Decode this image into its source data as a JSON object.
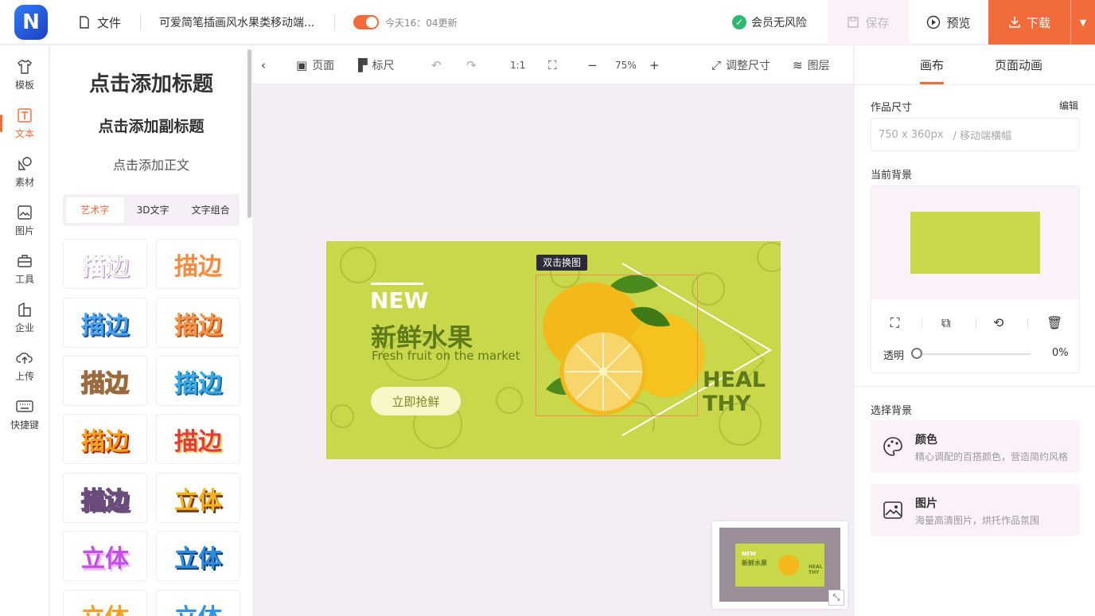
{
  "topbar": {
    "logo_letter": "N",
    "file_menu": "文件",
    "doc_title": "可爱简笔插画风水果类移动端...",
    "updated": "今天16：04更新",
    "member_safe": "会员无风险",
    "save": "保存",
    "preview": "预览",
    "download": "下载"
  },
  "nav": {
    "items": [
      {
        "label": "模板"
      },
      {
        "label": "文本"
      },
      {
        "label": "素材"
      },
      {
        "label": "图片"
      },
      {
        "label": "工具"
      },
      {
        "label": "企业"
      },
      {
        "label": "上传"
      },
      {
        "label": "快捷键"
      }
    ]
  },
  "text_panel": {
    "add_title": "点击添加标题",
    "add_subtitle": "点击添加副标题",
    "add_body": "点击添加正文",
    "tabs": [
      "艺术字",
      "3D文字",
      "文字组合"
    ],
    "styles": [
      "描边",
      "描边",
      "描边",
      "描边",
      "描边",
      "描边",
      "描边",
      "描边",
      "描边",
      "立体",
      "立体",
      "立体",
      "立体",
      "立体"
    ]
  },
  "toolbar": {
    "page": "页面",
    "ruler": "标尺",
    "ratio": "1:1",
    "zoom": "75%",
    "resize": "调整尺寸",
    "layers": "图层"
  },
  "banner": {
    "tooltip": "双击换图",
    "new": "NEW",
    "title": "新鲜水果",
    "subtitle": "Fresh fruit on the market",
    "cta": "立即抢鲜",
    "healthy_1": "HEAL",
    "healthy_2": "THY"
  },
  "right_panel": {
    "tab_canvas": "画布",
    "tab_animation": "页面动画",
    "size_label": "作品尺寸",
    "edit": "编辑",
    "size_value": "750 x 360px",
    "size_type": "/ 移动端横幅",
    "current_bg": "当前背景",
    "opacity_label": "透明",
    "opacity_value": "0%",
    "choose_bg": "选择背景",
    "options": [
      {
        "title": "颜色",
        "desc": "精心调配的百搭颜色，营造简约风格"
      },
      {
        "title": "图片",
        "desc": "海量高清图片，烘托作品氛围"
      }
    ]
  },
  "colors": {
    "accent": "#f26b3a",
    "banner_bg": "#c9d84a",
    "banner_text": "#5f7a1a"
  },
  "minimap": {
    "new": "NEW",
    "title": "新鲜水果",
    "healthy_1": "HEAL",
    "healthy_2": "THY"
  }
}
